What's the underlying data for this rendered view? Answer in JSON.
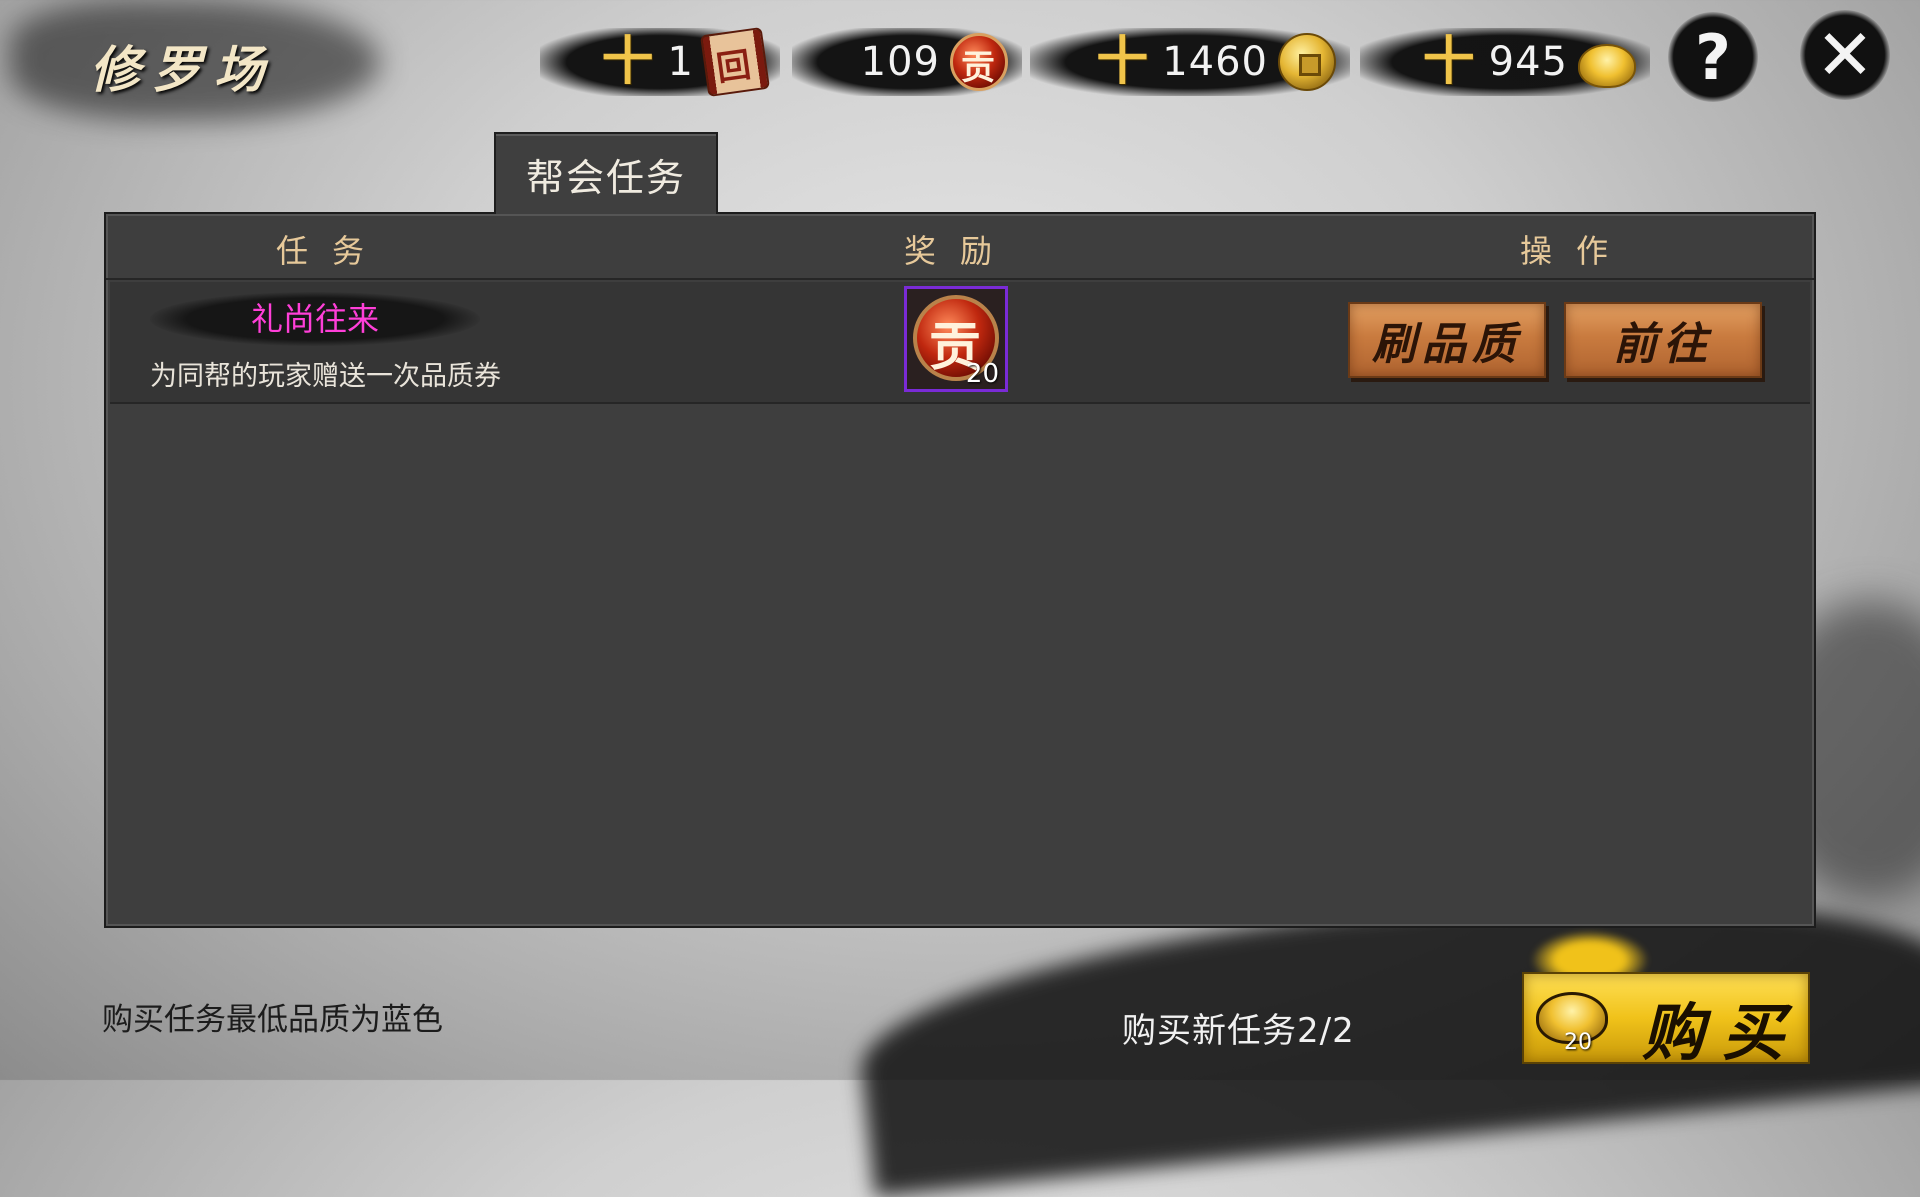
{
  "header": {
    "title": "修罗场"
  },
  "resources": [
    {
      "name": "scroll",
      "plus": "十",
      "value": "1",
      "icon": "scroll-icon"
    },
    {
      "name": "contribution",
      "plus": "",
      "value": "109",
      "icon": "contribution-icon"
    },
    {
      "name": "copper-coin",
      "plus": "十",
      "value": "1460",
      "icon": "coin-icon"
    },
    {
      "name": "gold-ingot",
      "plus": "十",
      "value": "945",
      "icon": "gold-ingot-icon"
    }
  ],
  "buttons": {
    "help": "?",
    "close": "✕"
  },
  "tab": {
    "label": "帮会任务"
  },
  "table": {
    "headers": [
      "任务",
      "奖励",
      "操作"
    ],
    "rows": [
      {
        "name": "礼尚往来",
        "name_color": "#ff3fd8",
        "description": "为同帮的玩家赠送一次品质券",
        "reward_icon": "contribution-icon",
        "reward_count": "20",
        "actions": [
          "刷品质",
          "前往"
        ]
      }
    ]
  },
  "footer": {
    "note": "购买任务最低品质为蓝色",
    "buy_count": "购买新任务2/2",
    "buy_cost": "20",
    "buy_label": "购买"
  }
}
